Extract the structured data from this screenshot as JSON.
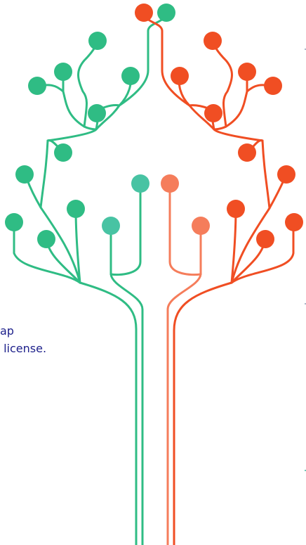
{
  "partial_text": {
    "line1": "ap",
    "line2": " license."
  },
  "colors": {
    "green": "#2fbc84",
    "teal": "#48c3a3",
    "red": "#f04e23",
    "coral": "#f57d5b",
    "text": "#1c1f8a"
  }
}
